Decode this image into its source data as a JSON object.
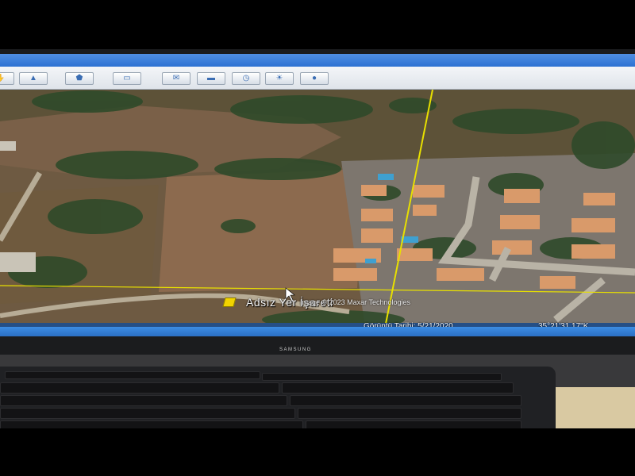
{
  "map": {
    "placemark_label": "Adsız Yer İşareti",
    "copyright": "Image © 2023 Maxar Technologies"
  },
  "status_bar": {
    "imagery_date": "Görüntü Tarihi: 5/21/2020",
    "coordinates": "35°21'31.17\"K"
  },
  "monitor": {
    "brand": "SAMSUNG"
  },
  "toolbar": {
    "buttons": [
      {
        "icon": "hand-icon"
      },
      {
        "icon": "placemark-icon"
      },
      {
        "icon": "polygon-icon"
      },
      {
        "icon": "path-icon"
      },
      {
        "icon": "image-overlay-icon"
      },
      {
        "icon": "tour-icon"
      },
      {
        "icon": "historical-imagery-icon"
      },
      {
        "icon": "sun-icon"
      },
      {
        "icon": "planet-icon"
      }
    ]
  },
  "colors": {
    "placemark": "#f2d400",
    "grid_line": "#e8e000",
    "window_accent": "#2d72d2"
  }
}
